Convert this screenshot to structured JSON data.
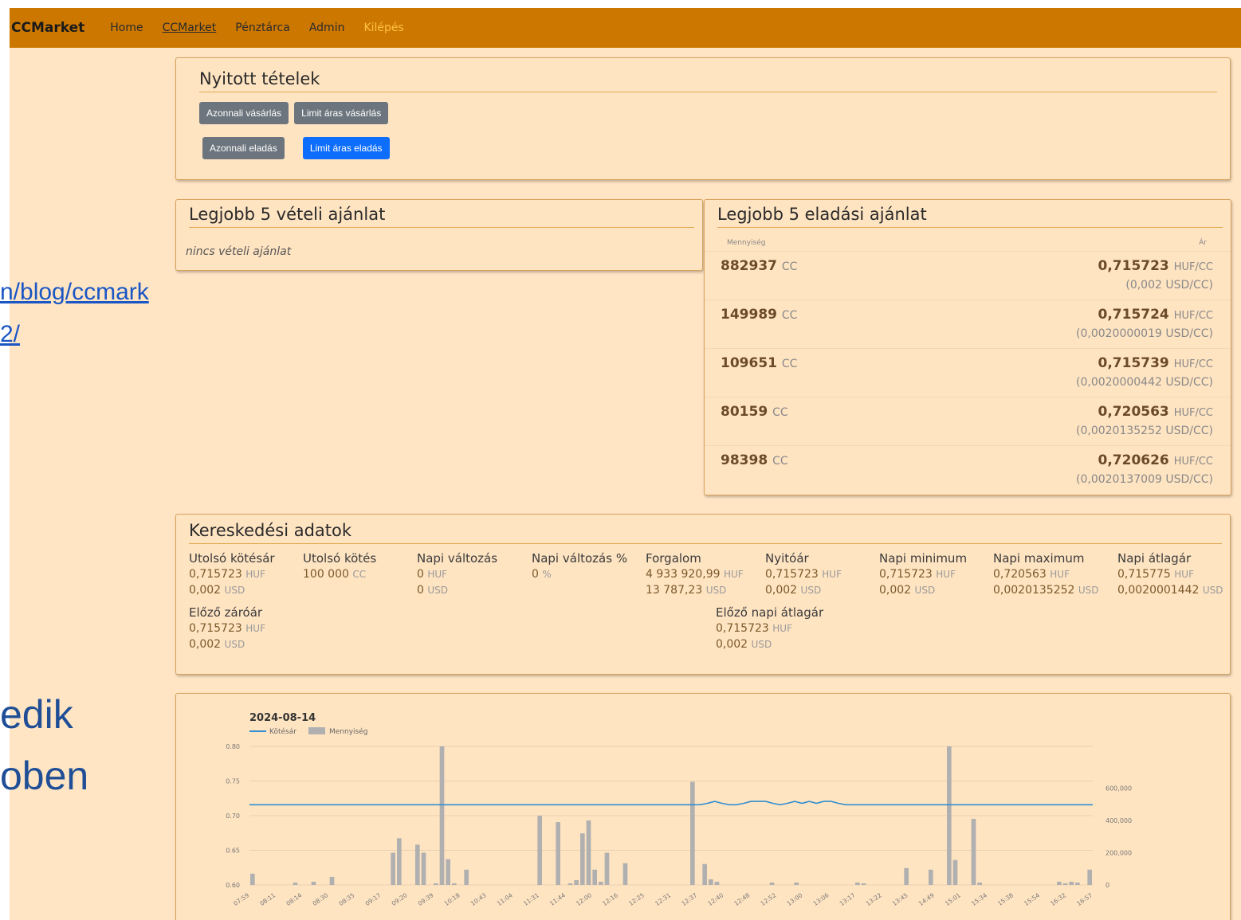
{
  "background": {
    "link_line1": "n/blog/ccmark",
    "link_line2": "2/",
    "big_line1": "edik",
    "big_line2": "oben"
  },
  "nav": {
    "brand": "CCMarket",
    "links": [
      "Home",
      "CCMarket",
      "Pénztárca",
      "Admin",
      "Kilépés"
    ]
  },
  "open_orders": {
    "title": "Nyitott tételek",
    "buttons": [
      "Azonnali vásárlás",
      "Limit áras vásárlás",
      "Azonnali eladás",
      "Limit áras eladás"
    ]
  },
  "bids": {
    "title": "Legjobb 5 vételi ajánlat",
    "empty": "nincs vételi ajánlat"
  },
  "asks": {
    "title": "Legjobb 5 eladási ajánlat",
    "col_qty": "Mennyiség",
    "col_price": "Ár",
    "qty_unit": "CC",
    "price_unit": "HUF/CC",
    "rows": [
      {
        "qty": "882937",
        "price": "0,715723",
        "usd": "(0,002 USD/CC)"
      },
      {
        "qty": "149989",
        "price": "0,715724",
        "usd": "(0,0020000019 USD/CC)"
      },
      {
        "qty": "109651",
        "price": "0,715739",
        "usd": "(0,0020000442 USD/CC)"
      },
      {
        "qty": "80159",
        "price": "0,720563",
        "usd": "(0,0020135252 USD/CC)"
      },
      {
        "qty": "98398",
        "price": "0,720626",
        "usd": "(0,0020137009 USD/CC)"
      }
    ]
  },
  "trading": {
    "title": "Kereskedési adatok",
    "stats": [
      {
        "label": "Utolsó kötésár",
        "l1": "0,715723",
        "u1": "HUF",
        "l2": "0,002",
        "u2": "USD"
      },
      {
        "label": "Utolsó kötés",
        "l1": "100 000",
        "u1": "CC",
        "l2": "",
        "u2": ""
      },
      {
        "label": "Napi változás",
        "l1": "0",
        "u1": "HUF",
        "l2": "0",
        "u2": "USD"
      },
      {
        "label": "Napi változás %",
        "l1": "0",
        "u1": "%",
        "l2": "",
        "u2": ""
      },
      {
        "label": "Forgalom",
        "l1": "4 933 920,99",
        "u1": "HUF",
        "l2": "13 787,23",
        "u2": "USD"
      },
      {
        "label": "Nyitóár",
        "l1": "0,715723",
        "u1": "HUF",
        "l2": "0,002",
        "u2": "USD"
      },
      {
        "label": "Napi minimum",
        "l1": "0,715723",
        "u1": "HUF",
        "l2": "0,002",
        "u2": "USD"
      },
      {
        "label": "Napi maximum",
        "l1": "0,720563",
        "u1": "HUF",
        "l2": "0,0020135252",
        "u2": "USD"
      },
      {
        "label": "Napi átlagár",
        "l1": "0,715775",
        "u1": "HUF",
        "l2": "0,0020001442",
        "u2": "USD"
      },
      {
        "label": "Előző záróár",
        "l1": "0,715723",
        "u1": "HUF",
        "l2": "0,002",
        "u2": "USD"
      },
      {
        "label": "Előző napi átlagár",
        "l1": "0,715723",
        "u1": "HUF",
        "l2": "0,002",
        "u2": "USD"
      }
    ]
  },
  "chart_data": {
    "type": "line",
    "title": "2024-08-14",
    "legend": [
      "Kötésár",
      "Mennyiség"
    ],
    "legend_position": "top-left",
    "grid": true,
    "y_left": {
      "ticks": [
        "0.80",
        "0.75",
        "0.70",
        "0.65",
        "0.60"
      ],
      "range": [
        0.6,
        0.8
      ]
    },
    "y_right": {
      "ticks": [
        "600,000",
        "400,000",
        "200,000",
        "0"
      ],
      "range": [
        0,
        860000
      ]
    },
    "x_ticks": [
      "07:59",
      "08:11",
      "08:14",
      "08:30",
      "08:35",
      "09:17",
      "09:20",
      "09:39",
      "10:18",
      "10:43",
      "11:04",
      "11:31",
      "11:44",
      "12:00",
      "12:16",
      "12:25",
      "12:31",
      "12:37",
      "12:40",
      "12:48",
      "12:52",
      "13:00",
      "13:06",
      "13:17",
      "13:22",
      "13:45",
      "14:49",
      "15:01",
      "15:34",
      "15:38",
      "15:54",
      "16:32",
      "16:57"
    ],
    "price_series": [
      0.7157,
      0.7157,
      0.7157,
      0.7157,
      0.7157,
      0.7157,
      0.7157,
      0.7157,
      0.7157,
      0.7157,
      0.7157,
      0.7157,
      0.7157,
      0.7157,
      0.7157,
      0.7157,
      0.7157,
      0.7157,
      0.7157,
      0.7157,
      0.7157,
      0.7157,
      0.7157,
      0.7157,
      0.7157,
      0.7157,
      0.7157,
      0.7157,
      0.7157,
      0.7157,
      0.7157,
      0.7157,
      0.7157,
      0.7157,
      0.7157,
      0.7157,
      0.7157,
      0.7157,
      0.7157,
      0.7157,
      0.7157,
      0.7157,
      0.7157,
      0.7157,
      0.7157,
      0.7157,
      0.7157,
      0.7157,
      0.7157,
      0.7157,
      0.7157,
      0.7157,
      0.7157,
      0.7157,
      0.7157,
      0.7157,
      0.7157,
      0.7157,
      0.7157,
      0.7157,
      0.7157,
      0.7157,
      0.7159,
      0.7178,
      0.7206,
      0.7178,
      0.7157,
      0.7157,
      0.7178,
      0.7206,
      0.7206,
      0.7206,
      0.7178,
      0.7157,
      0.7178,
      0.7206,
      0.7178,
      0.7206,
      0.7178,
      0.7206,
      0.7206,
      0.7178,
      0.7157,
      0.7157,
      0.7157,
      0.7157,
      0.7157,
      0.7157,
      0.7157,
      0.7157,
      0.7157,
      0.7157,
      0.7157,
      0.7157,
      0.7157,
      0.7157,
      0.7157,
      0.7157,
      0.7157,
      0.7157,
      0.7157,
      0.7157,
      0.7157,
      0.7157,
      0.7157,
      0.7157,
      0.7157,
      0.7157,
      0.7157,
      0.7157,
      0.7157,
      0.7157,
      0.7157,
      0.7157,
      0.7157,
      0.7157,
      0.7157
    ],
    "volume_series": [
      70000,
      0,
      0,
      0,
      0,
      0,
      0,
      15000,
      0,
      0,
      20000,
      0,
      0,
      50000,
      0,
      0,
      0,
      0,
      0,
      0,
      0,
      0,
      0,
      200000,
      290000,
      0,
      0,
      250000,
      200000,
      0,
      10000,
      860000,
      160000,
      10000,
      0,
      95000,
      0,
      0,
      0,
      0,
      0,
      0,
      0,
      0,
      0,
      0,
      0,
      430000,
      0,
      0,
      390000,
      0,
      10000,
      30000,
      320000,
      400000,
      95000,
      20000,
      200000,
      0,
      0,
      135000,
      0,
      0,
      0,
      0,
      0,
      0,
      0,
      0,
      0,
      0,
      640000,
      0,
      130000,
      35000,
      20000,
      0,
      0,
      0,
      0,
      0,
      0,
      0,
      0,
      15000,
      0,
      0,
      0,
      15000,
      0,
      0,
      0,
      0,
      0,
      0,
      0,
      0,
      0,
      15000,
      10000,
      0,
      0,
      0,
      0,
      0,
      0,
      105000,
      0,
      0,
      0,
      95000,
      0,
      0,
      860000,
      155000,
      0,
      0,
      410000,
      15000,
      0,
      0,
      0,
      0,
      0,
      0,
      0,
      0,
      0,
      0,
      0,
      0,
      20000,
      10000,
      20000,
      15000,
      0,
      95000
    ]
  }
}
